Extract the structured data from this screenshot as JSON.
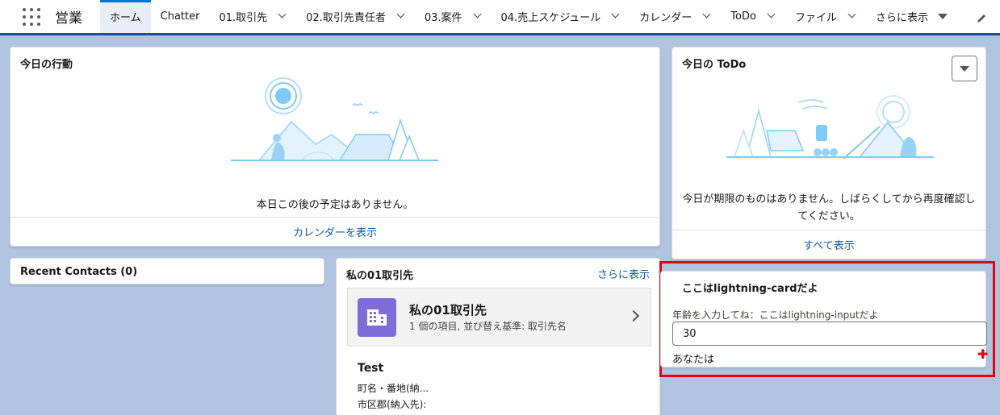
{
  "nav": {
    "app_name": "営業",
    "tabs": [
      {
        "label": "ホーム"
      },
      {
        "label": "Chatter"
      },
      {
        "label": "01.取引先"
      },
      {
        "label": "02.取引先責任者"
      },
      {
        "label": "03.案件"
      },
      {
        "label": "04.売上スケジュール"
      },
      {
        "label": "カレンダー"
      },
      {
        "label": "ToDo"
      },
      {
        "label": "ファイル"
      },
      {
        "label": "さらに表示"
      }
    ]
  },
  "events_card": {
    "title": "今日の行動",
    "empty_text": "本日この後の予定はありません。",
    "footer_link": "カレンダーを表示"
  },
  "todo_card": {
    "title": "今日の ToDo",
    "empty_text": "今日が期限のものはありません。しばらくしてから再度確認し\nてください。",
    "footer_link": "すべて表示"
  },
  "recent_contacts": {
    "title": "Recent Contacts (0)"
  },
  "accounts_card": {
    "title": "私の01取引先",
    "more_link": "さらに表示",
    "list_title": "私の01取引先",
    "list_sub": "1 個の項目, 並び替え基準: 取引先名",
    "record_name": "Test",
    "fields": [
      "町名・番地(納...",
      "市区郡(納入先):"
    ]
  },
  "lightning_card": {
    "title": "ここはlightning-cardだよ",
    "input_label": "年齢を入力してね：ここはlightning-inputだよ",
    "input_value": "30",
    "output_text": "あなたは"
  },
  "icons": {
    "app_launcher": "waffle-icon",
    "edit": "pencil-icon",
    "account": "building-icon",
    "plus": "plus-icon"
  },
  "colors": {
    "brand": "#0176d3",
    "link": "#0b5cab",
    "background": "#b0c4df",
    "highlight": "#e8000b",
    "account_icon": "#7f6ed8"
  }
}
